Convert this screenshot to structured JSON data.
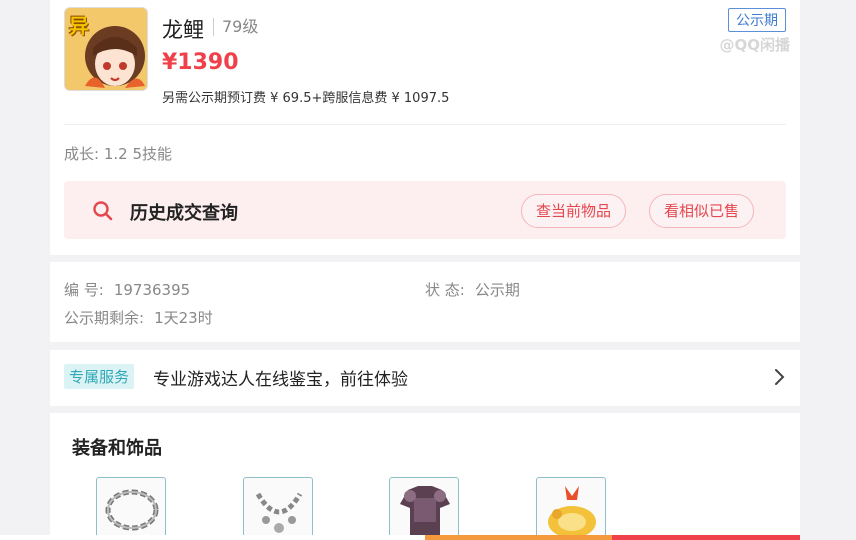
{
  "listing": {
    "avatar_badge": "异",
    "name": "龙鲤",
    "level": "79级",
    "price": "¥1390",
    "fee_note": "另需公示期预订费 ¥ 69.5+跨服信息费 ¥ 1097.5",
    "status_badge": "公示期",
    "watermark": "@QQ闲播",
    "growth": "成长: 1.2 5技能"
  },
  "history": {
    "label": "历史成交查询",
    "btn_current": "查当前物品",
    "btn_similar": "看相似已售"
  },
  "info": {
    "id_label": "编 号:",
    "id_value": "19736395",
    "state_label": "状 态:",
    "state_value": "公示期",
    "remain_label": "公示期剩余:",
    "remain_value": "1天23时"
  },
  "service": {
    "tag": "专属服务",
    "text": "专业游戏达人在线鉴宝，前往体验"
  },
  "equipment": {
    "title": "装备和饰品",
    "items": [
      "chain-item-1",
      "chain-item-2",
      "armor-item",
      "gold-ornament-item"
    ]
  },
  "colors": {
    "price_red": "#f0414a",
    "badge_blue": "#3d7bd0",
    "service_teal": "#2fa8b8",
    "bar_orange": "#f59a3c"
  }
}
